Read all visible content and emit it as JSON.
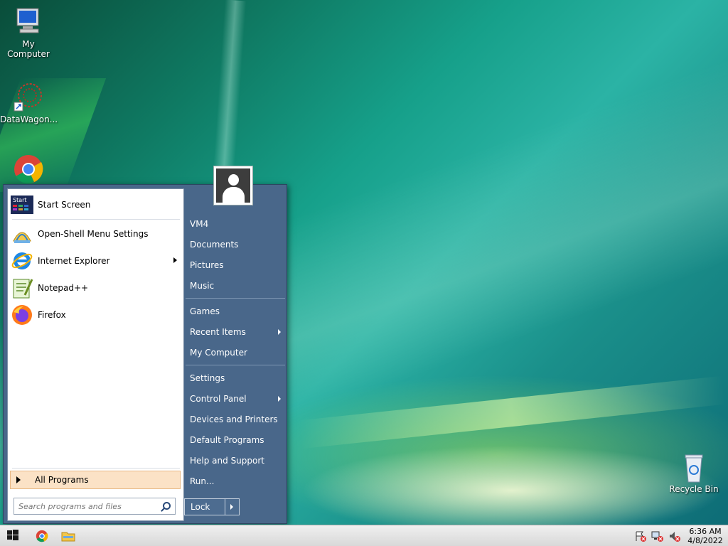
{
  "desktop": {
    "icons": [
      {
        "label": "My Computer"
      },
      {
        "label": "DataWagon..."
      },
      {
        "label": "Recycle Bin"
      }
    ]
  },
  "start_menu": {
    "programs": [
      {
        "label": "Start Screen",
        "icon": "start-screen-icon"
      },
      {
        "label": "Open-Shell Menu Settings",
        "icon": "open-shell-icon"
      },
      {
        "label": "Internet Explorer",
        "icon": "internet-explorer-icon",
        "submenu": true
      },
      {
        "label": "Notepad++",
        "icon": "notepadpp-icon"
      },
      {
        "label": "Firefox",
        "icon": "firefox-icon"
      }
    ],
    "start_tile_text": "Start",
    "all_programs": "All Programs",
    "search_placeholder": "Search programs and files",
    "right_items": [
      {
        "label": "VM4"
      },
      {
        "label": "Documents"
      },
      {
        "label": "Pictures"
      },
      {
        "label": "Music"
      },
      {
        "label": "Games"
      },
      {
        "label": "Recent Items",
        "submenu": true
      },
      {
        "label": "My Computer"
      },
      {
        "label": "Settings"
      },
      {
        "label": "Control Panel",
        "submenu": true
      },
      {
        "label": "Devices and Printers"
      },
      {
        "label": "Default Programs"
      },
      {
        "label": "Help and Support"
      },
      {
        "label": "Run..."
      }
    ],
    "lock_label": "Lock"
  },
  "taskbar": {
    "time": "6:36 AM",
    "date": "4/8/2022"
  },
  "colors": {
    "menu_right_bg": "#49678a",
    "all_programs_bg": "#fbe2c6",
    "desktop_teal": "#16a08a"
  }
}
